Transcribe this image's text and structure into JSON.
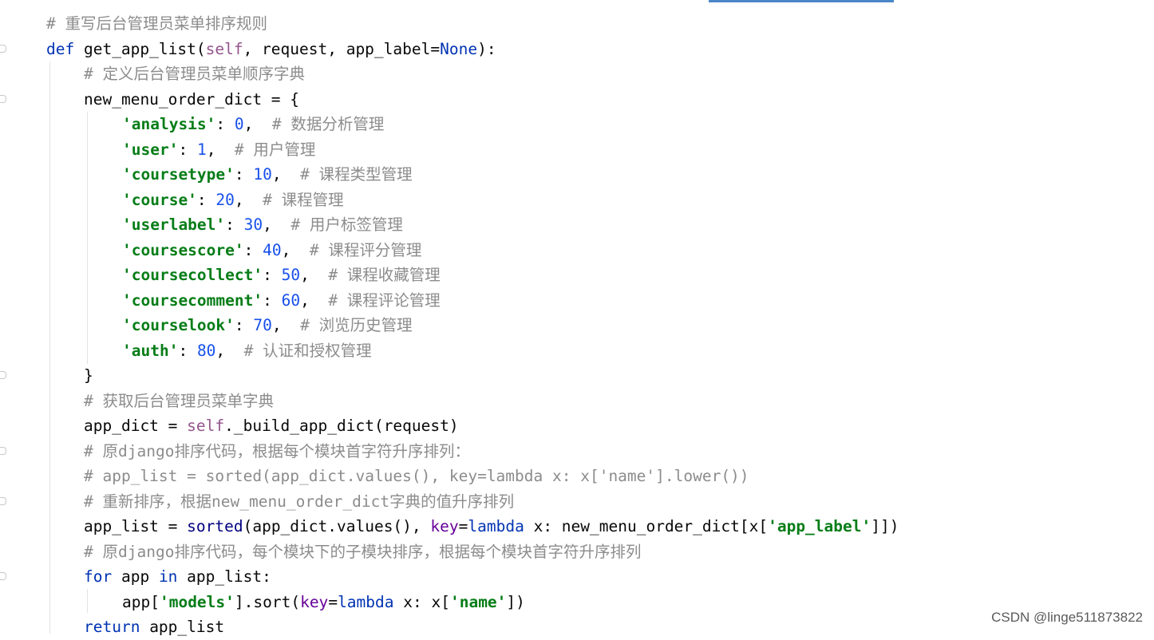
{
  "lines": [
    {
      "indent": 1,
      "tokens": [
        [
          "comment",
          "# "
        ],
        [
          "cjk",
          "重写后台管理员菜单排序规则"
        ]
      ]
    },
    {
      "indent": 1,
      "tokens": [
        [
          "kw",
          "def "
        ],
        [
          "fn",
          "get_app_list("
        ],
        [
          "self",
          "self"
        ],
        [
          "fn",
          ", request, app_label="
        ],
        [
          "kw",
          "None"
        ],
        [
          "fn",
          "):"
        ]
      ]
    },
    {
      "indent": 2,
      "tokens": [
        [
          "comment",
          "# "
        ],
        [
          "cjk",
          "定义后台管理员菜单顺序字典"
        ]
      ]
    },
    {
      "indent": 2,
      "tokens": [
        [
          "fn",
          "new_menu_order_dict = {"
        ]
      ]
    },
    {
      "indent": 3,
      "tokens": [
        [
          "str",
          "'analysis'"
        ],
        [
          "fn",
          ": "
        ],
        [
          "num",
          "0"
        ],
        [
          "fn",
          ",  "
        ],
        [
          "comment",
          "# "
        ],
        [
          "cjk",
          "数据分析管理"
        ]
      ]
    },
    {
      "indent": 3,
      "tokens": [
        [
          "str",
          "'user'"
        ],
        [
          "fn",
          ": "
        ],
        [
          "num",
          "1"
        ],
        [
          "fn",
          ",  "
        ],
        [
          "comment",
          "# "
        ],
        [
          "cjk",
          "用户管理"
        ]
      ]
    },
    {
      "indent": 3,
      "tokens": [
        [
          "str",
          "'coursetype'"
        ],
        [
          "fn",
          ": "
        ],
        [
          "num",
          "10"
        ],
        [
          "fn",
          ",  "
        ],
        [
          "comment",
          "# "
        ],
        [
          "cjk",
          "课程类型管理"
        ]
      ]
    },
    {
      "indent": 3,
      "tokens": [
        [
          "str",
          "'course'"
        ],
        [
          "fn",
          ": "
        ],
        [
          "num",
          "20"
        ],
        [
          "fn",
          ",  "
        ],
        [
          "comment",
          "# "
        ],
        [
          "cjk",
          "课程管理"
        ]
      ]
    },
    {
      "indent": 3,
      "tokens": [
        [
          "str",
          "'userlabel'"
        ],
        [
          "fn",
          ": "
        ],
        [
          "num",
          "30"
        ],
        [
          "fn",
          ",  "
        ],
        [
          "comment",
          "# "
        ],
        [
          "cjk",
          "用户标签管理"
        ]
      ]
    },
    {
      "indent": 3,
      "tokens": [
        [
          "str",
          "'coursescore'"
        ],
        [
          "fn",
          ": "
        ],
        [
          "num",
          "40"
        ],
        [
          "fn",
          ",  "
        ],
        [
          "comment",
          "# "
        ],
        [
          "cjk",
          "课程评分管理"
        ]
      ]
    },
    {
      "indent": 3,
      "tokens": [
        [
          "str",
          "'coursecollect'"
        ],
        [
          "fn",
          ": "
        ],
        [
          "num",
          "50"
        ],
        [
          "fn",
          ",  "
        ],
        [
          "comment",
          "# "
        ],
        [
          "cjk",
          "课程收藏管理"
        ]
      ]
    },
    {
      "indent": 3,
      "tokens": [
        [
          "str",
          "'coursecomment'"
        ],
        [
          "fn",
          ": "
        ],
        [
          "num",
          "60"
        ],
        [
          "fn",
          ",  "
        ],
        [
          "comment",
          "# "
        ],
        [
          "cjk",
          "课程评论管理"
        ]
      ]
    },
    {
      "indent": 3,
      "tokens": [
        [
          "str",
          "'courselook'"
        ],
        [
          "fn",
          ": "
        ],
        [
          "num",
          "70"
        ],
        [
          "fn",
          ",  "
        ],
        [
          "comment",
          "# "
        ],
        [
          "cjk",
          "浏览历史管理"
        ]
      ]
    },
    {
      "indent": 3,
      "tokens": [
        [
          "str",
          "'auth'"
        ],
        [
          "fn",
          ": "
        ],
        [
          "num",
          "80"
        ],
        [
          "fn",
          ",  "
        ],
        [
          "comment",
          "# "
        ],
        [
          "cjk",
          "认证和授权管理"
        ]
      ]
    },
    {
      "indent": 2,
      "tokens": [
        [
          "fn",
          "}"
        ]
      ]
    },
    {
      "indent": 2,
      "tokens": [
        [
          "comment",
          "# "
        ],
        [
          "cjk",
          "获取后台管理员菜单字典"
        ]
      ]
    },
    {
      "indent": 2,
      "tokens": [
        [
          "fn",
          "app_dict = "
        ],
        [
          "self",
          "self"
        ],
        [
          "fn",
          "._build_app_dict(request)"
        ]
      ]
    },
    {
      "indent": 2,
      "tokens": [
        [
          "comment",
          "# "
        ],
        [
          "cjk",
          "原"
        ],
        [
          "comment",
          "django"
        ],
        [
          "cjk",
          "排序代码，根据每个模块首字符升序排列："
        ]
      ]
    },
    {
      "indent": 2,
      "tokens": [
        [
          "comment",
          "# app_list = sorted(app_dict.values(), key=lambda x: x['name'].lower())"
        ]
      ]
    },
    {
      "indent": 2,
      "tokens": [
        [
          "comment",
          "# "
        ],
        [
          "cjk",
          "重新排序，根据"
        ],
        [
          "comment",
          "new_menu_order_dict"
        ],
        [
          "cjk",
          "字典的值升序排列"
        ]
      ]
    },
    {
      "indent": 2,
      "tokens": [
        [
          "fn",
          "app_list = "
        ],
        [
          "builtin",
          "sorted"
        ],
        [
          "fn",
          "(app_dict.values(), "
        ],
        [
          "param",
          "key"
        ],
        [
          "fn",
          "="
        ],
        [
          "kw",
          "lambda"
        ],
        [
          "fn",
          " x: new_menu_order_dict[x["
        ],
        [
          "str",
          "'app_label'"
        ],
        [
          "fn",
          "]])"
        ]
      ]
    },
    {
      "indent": 2,
      "tokens": [
        [
          "comment",
          "# "
        ],
        [
          "cjk",
          "原"
        ],
        [
          "comment",
          "django"
        ],
        [
          "cjk",
          "排序代码，每个模块下的子模块排序，根据每个模块首字符升序排列"
        ]
      ]
    },
    {
      "indent": 2,
      "tokens": [
        [
          "kw",
          "for"
        ],
        [
          "fn",
          " app "
        ],
        [
          "kw",
          "in"
        ],
        [
          "fn",
          " app_list:"
        ]
      ]
    },
    {
      "indent": 3,
      "tokens": [
        [
          "fn",
          "app["
        ],
        [
          "str",
          "'models'"
        ],
        [
          "fn",
          "].sort("
        ],
        [
          "param",
          "key"
        ],
        [
          "fn",
          "="
        ],
        [
          "kw",
          "lambda"
        ],
        [
          "fn",
          " x: x["
        ],
        [
          "str",
          "'name'"
        ],
        [
          "fn",
          "])"
        ]
      ]
    },
    {
      "indent": 2,
      "tokens": [
        [
          "kw",
          "return"
        ],
        [
          "fn",
          " app_list"
        ]
      ]
    }
  ],
  "watermark": "CSDN @linge511873822"
}
